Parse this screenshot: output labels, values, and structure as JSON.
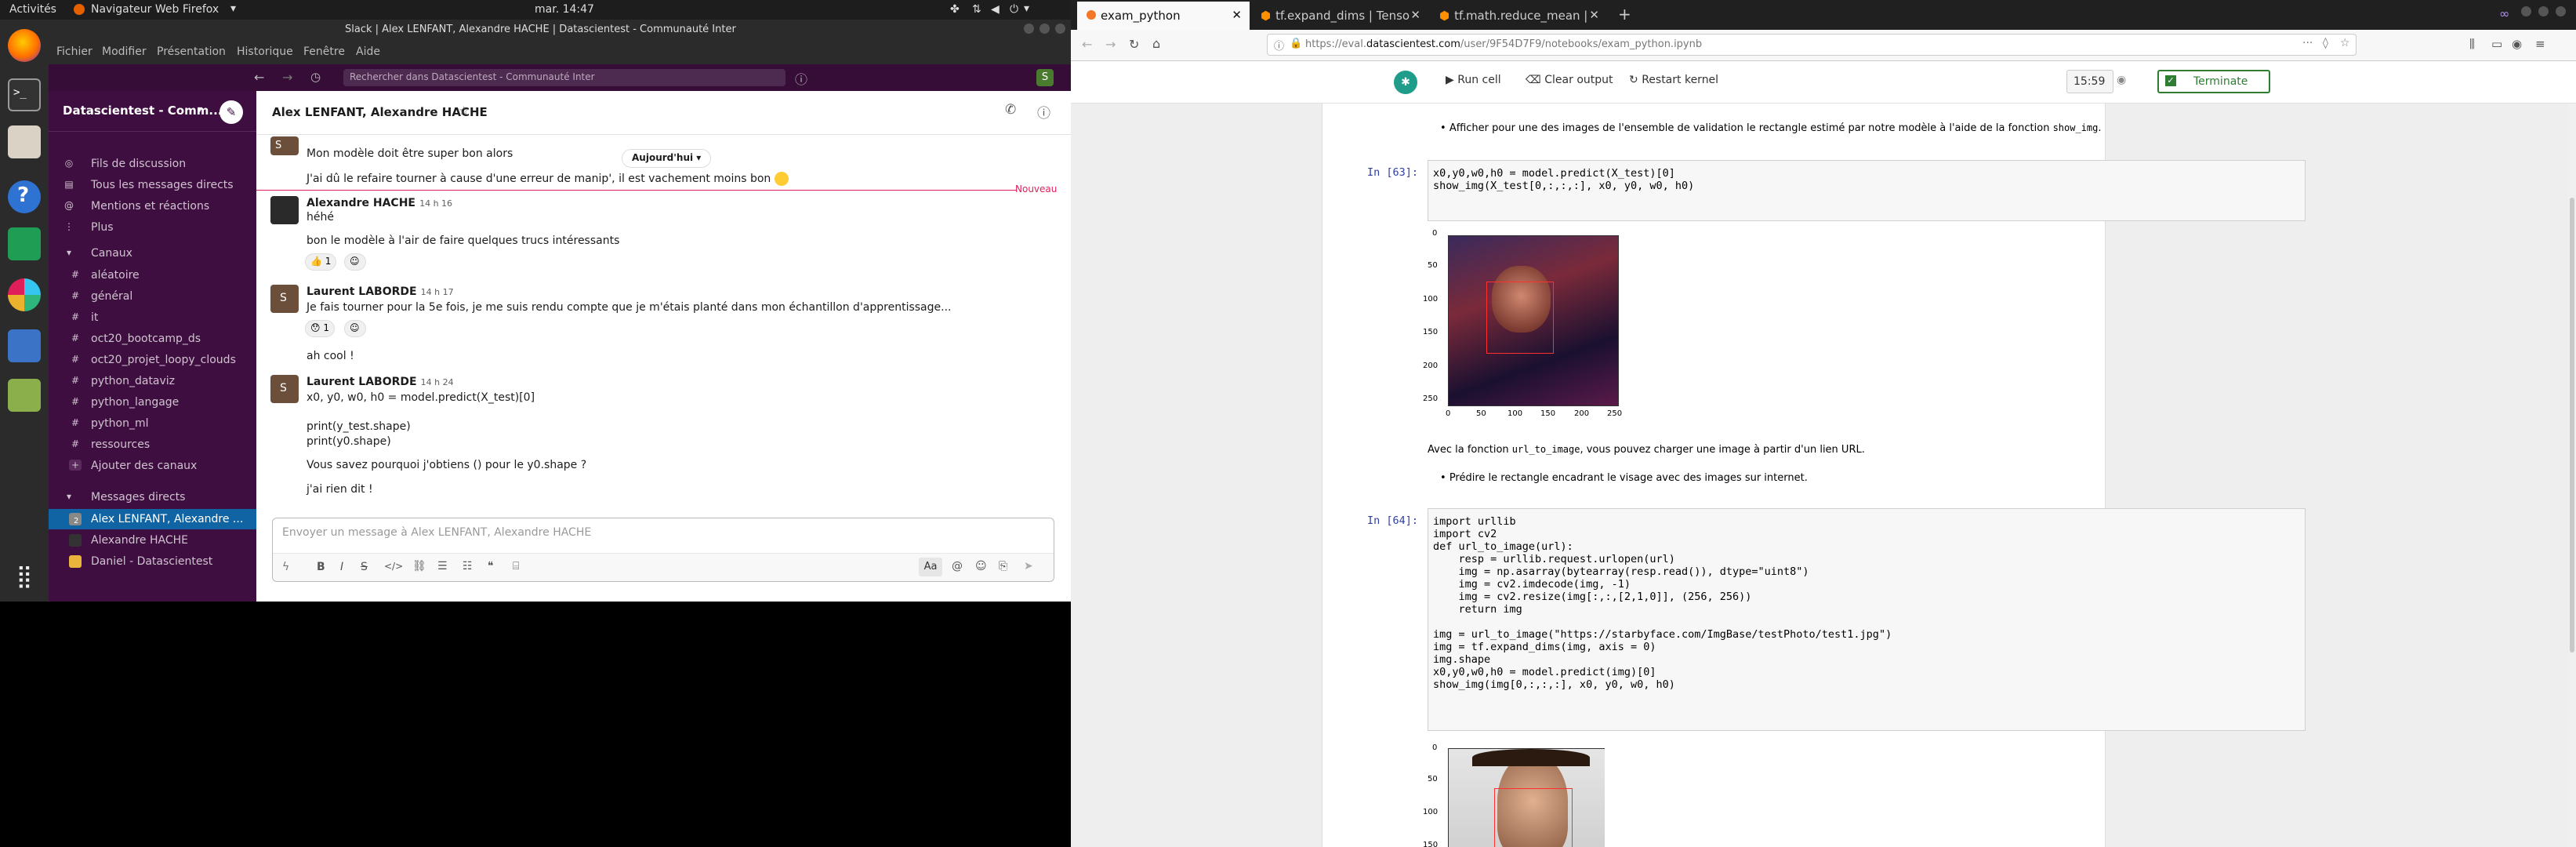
{
  "topbar": {
    "activities": "Activités",
    "app": "Navigateur Web Firefox",
    "clock": "mar. 14:47"
  },
  "slack": {
    "window_title": "Slack | Alex LENFANT, Alexandre HACHE | Datascientest - Communauté Inter",
    "menu": [
      "Fichier",
      "Modifier",
      "Présentation",
      "Historique",
      "Fenêtre",
      "Aide"
    ],
    "search_placeholder": "Rechercher dans Datascientest - Communauté Inter",
    "user_initial": "S",
    "workspace": "Datascientest - Comm...",
    "nav": [
      "Fils de discussion",
      "Tous les messages directs",
      "Mentions et réactions",
      "Plus"
    ],
    "channels_header": "Canaux",
    "channels": [
      "aléatoire",
      "général",
      "it",
      "oct20_bootcamp_ds",
      "oct20_projet_loopy_clouds",
      "python_dataviz",
      "python_langage",
      "python_ml",
      "ressources"
    ],
    "add_channels": "Ajouter des canaux",
    "dm_header": "Messages directs",
    "dms": [
      {
        "name": "Alex LENFANT, Alexandre ...",
        "badge": "2"
      },
      {
        "name": "Alexandre HACHE"
      },
      {
        "name": "Daniel - Datascientest"
      }
    ],
    "conversation_title": "Alex LENFANT, Alexandre HACHE",
    "date_pill": "Aujourd'hui",
    "new_label": "Nouveau",
    "messages": {
      "m0_text1": "Mon modèle doit être super bon alors",
      "m0_text2": "J'ai dû le refaire tourner à cause d'une erreur de manip', il est vachement moins bon",
      "m1_name": "Alexandre HACHE",
      "m1_time": "14 h 16",
      "m1_text1": "héhé",
      "m1_text2": "bon le modèle à l'air de faire quelques trucs intéressants",
      "m1_react_count": "1",
      "m2_name": "Laurent LABORDE",
      "m2_time": "14 h 17",
      "m2_text1": "Je fais tourner pour la 5e fois, je me suis rendu compte que je m'étais planté dans mon échantillon d'apprentissage...",
      "m2_react_count": "1",
      "m2_text2": "ah cool !",
      "m3_name": "Laurent LABORDE",
      "m3_time": "14 h 24",
      "m3_text1": "x0, y0, w0, h0 = model.predict(X_test)[0]",
      "m3_text2": "print(y_test.shape)",
      "m3_text3": "print(y0.shape)",
      "m3_text4": "Vous savez pourquoi j'obtiens () pour le y0.shape ?",
      "m3_text5": "j'ai rien dit !"
    },
    "composer_placeholder": "Envoyer un message à Alex LENFANT, Alexandre HACHE",
    "composer_aa": "Aa"
  },
  "firefox": {
    "tabs": [
      {
        "label": "exam_python"
      },
      {
        "label": "tf.expand_dims | Tenso"
      },
      {
        "label": "tf.math.reduce_mean |"
      }
    ],
    "url_prefix": "https://eval.",
    "url_host": "datascientest.com",
    "url_path": "/user/9F54D7F9/notebooks/exam_python.ipynb"
  },
  "jupyter": {
    "run_cell": "Run cell",
    "clear_output": "Clear output",
    "restart_kernel": "Restart kernel",
    "timer": "15:59",
    "terminate": "Terminate",
    "bullet1_prefix": "Afficher pour une des images de l'ensemble de validation le rectangle estimé par notre modèle à l'aide de la fonction ",
    "bullet1_code": "show_img",
    "prompt63": "In [63]:",
    "code63_line1": "x0,y0,w0,h0 = model.predict(X_test)[0]",
    "code63_line2": "show_img(X_test[0,:,:,:], x0, y0, w0, h0)",
    "plot1_yticks": [
      "0",
      "50",
      "100",
      "150",
      "200",
      "250"
    ],
    "plot1_xticks": [
      "0",
      "50",
      "100",
      "150",
      "200",
      "250"
    ],
    "md2_prefix": "Avec la fonction ",
    "md2_code": "url_to_image",
    "md2_suffix": ", vous pouvez charger une image à partir d'un lien URL.",
    "bullet2": "Prédire le rectangle encadrant le visage avec des images sur internet.",
    "prompt64": "In [64]:",
    "code64_lines": [
      "import urllib",
      "import cv2",
      "def url_to_image(url):",
      "    resp = urllib.request.urlopen(url)",
      "    img = np.asarray(bytearray(resp.read()), dtype=\"uint8\")",
      "    img = cv2.imdecode(img, -1)",
      "    img = cv2.resize(img[:,:,[2,1,0]], (256, 256))",
      "    return img",
      "",
      "img = url_to_image(\"https://starbyface.com/ImgBase/testPhoto/test1.jpg\")",
      "img = tf.expand_dims(img, axis = 0)",
      "img.shape",
      "x0,y0,w0,h0 = model.predict(img)[0]",
      "show_img(img[0,:,:,:], x0, y0, w0, h0)"
    ],
    "plot2_yticks": [
      "0",
      "50",
      "100",
      "150"
    ]
  },
  "colors": {
    "slack_sidebar": "#3f0e40",
    "slack_active": "#1164a3",
    "new_line": "#e01e5a",
    "jupyter_prompt": "#303f9f",
    "terminate_green": "#2e7d32",
    "rect_red": "#ff3030"
  }
}
